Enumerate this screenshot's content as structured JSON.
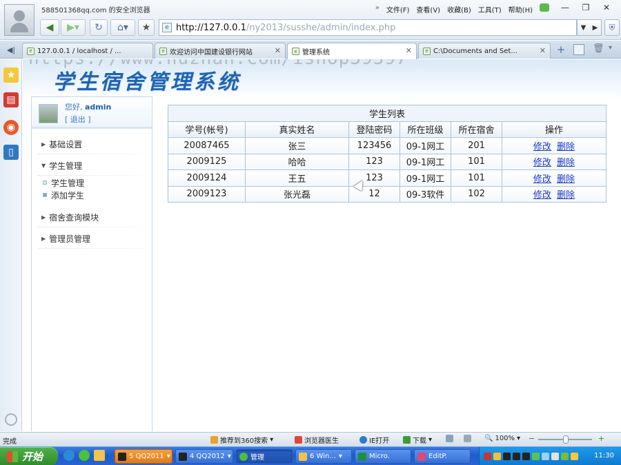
{
  "browser": {
    "title": "588501368qq.com 的安全浏览器",
    "menu": [
      "文件(F)",
      "查看(V)",
      "收藏(B)",
      "工具(T)",
      "帮助(H)"
    ],
    "url_host": "http://127.0.0.1",
    "url_path": "/ny2013/susshe/admin/index.php",
    "tabs": [
      {
        "label": "127.0.0.1 / localhost / ...",
        "active": false
      },
      {
        "label": "欢迎访问中国建设银行网站",
        "active": false
      },
      {
        "label": "管理系统",
        "active": true
      },
      {
        "label": "C:\\Documents and Set...",
        "active": false
      }
    ]
  },
  "watermark": "https://www.huzhan.com/ishop39397",
  "site": {
    "logo_text": "学生宿舍管理系统"
  },
  "user": {
    "greeting_prefix": "您好,",
    "name": "admin",
    "logout": "[ 退出 ]"
  },
  "nav": {
    "items": [
      {
        "label": "基础设置",
        "expanded": false
      },
      {
        "label": "学生管理",
        "expanded": true
      },
      {
        "label": "宿舍查询模块",
        "expanded": false
      },
      {
        "label": "管理员管理",
        "expanded": false
      }
    ],
    "student_sub": [
      "学生管理",
      "添加学生"
    ]
  },
  "table": {
    "title": "学生列表",
    "columns": [
      "学号(帐号)",
      "真实姓名",
      "登陆密码",
      "所在班级",
      "所在宿舍",
      "操作"
    ],
    "edit_label": "修改",
    "delete_label": "删除",
    "rows": [
      {
        "id": "20087465",
        "name": "张三",
        "password": "123456",
        "class": "09-1网工",
        "dorm": "201"
      },
      {
        "id": "2009125",
        "name": "哈哈",
        "password": "123",
        "class": "09-1网工",
        "dorm": "101"
      },
      {
        "id": "2009124",
        "name": "王五",
        "password": "123",
        "class": "09-1网工",
        "dorm": "101"
      },
      {
        "id": "2009123",
        "name": "张光磊",
        "password": "12",
        "class": "09-3软件",
        "dorm": "102"
      }
    ]
  },
  "statusbar": {
    "status": "完成",
    "recommend": "推荐到360搜索",
    "doctor": "浏览器医生",
    "ie_open": "IE打开",
    "download": "下载",
    "zoom": "100%"
  },
  "taskbar": {
    "start": "开始",
    "tasks": [
      {
        "label": "5 QQ2011",
        "state": "flash"
      },
      {
        "label": "4 QQ2012",
        "state": "normal"
      },
      {
        "label": "管理",
        "state": "active"
      },
      {
        "label": "6 Win...",
        "state": "normal"
      },
      {
        "label": "Micro.",
        "state": "normal"
      },
      {
        "label": "EditP.",
        "state": "normal"
      }
    ],
    "clock": "11:30"
  },
  "colors": {
    "link": "#1a36c4",
    "logo": "#1f63b5",
    "taskbar": "#2a63cf",
    "start": "#2d8a2b"
  }
}
